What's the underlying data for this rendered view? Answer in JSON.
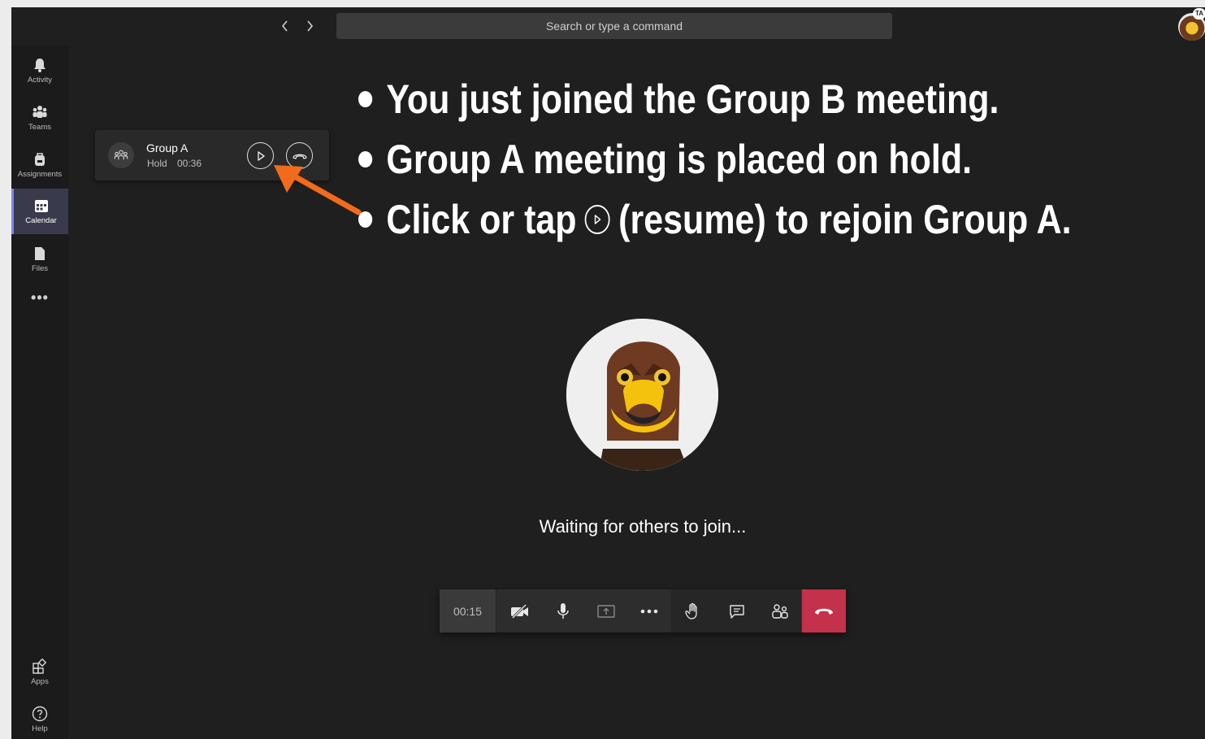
{
  "topbar": {
    "search_placeholder": "Search or type a command",
    "user_badge": "TA"
  },
  "rail": {
    "items": [
      {
        "label": "Activity",
        "icon": "bell-icon"
      },
      {
        "label": "Teams",
        "icon": "teams-icon"
      },
      {
        "label": "Assignments",
        "icon": "backpack-icon"
      },
      {
        "label": "Calendar",
        "icon": "calendar-icon",
        "active": true
      },
      {
        "label": "Files",
        "icon": "file-icon"
      }
    ],
    "more": "•••",
    "bottom": [
      {
        "label": "Apps",
        "icon": "apps-icon"
      },
      {
        "label": "Help",
        "icon": "help-icon"
      }
    ]
  },
  "hold_card": {
    "title": "Group A",
    "status": "Hold",
    "time": "00:36"
  },
  "annotation": {
    "line1": "You just joined the Group B meeting.",
    "line2": "Group A meeting is placed on hold.",
    "line3_before": "Click or tap",
    "line3_after": "(resume) to rejoin Group A."
  },
  "main": {
    "waiting_text": "Waiting for others to join..."
  },
  "controls": {
    "timer": "00:15"
  },
  "colors": {
    "background": "#1f1f1f",
    "accent": "#7b83eb",
    "hangup": "#c4314b",
    "arrow": "#f26a1b"
  }
}
